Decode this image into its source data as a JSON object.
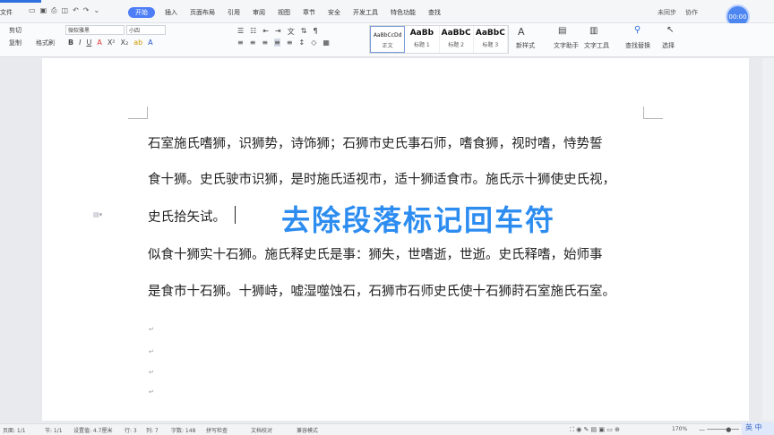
{
  "menubar": {
    "file_label": "文件",
    "tabs": [
      {
        "label": "开始",
        "active": true
      },
      {
        "label": "插入"
      },
      {
        "label": "页面布局"
      },
      {
        "label": "引用"
      },
      {
        "label": "审阅"
      },
      {
        "label": "视图"
      },
      {
        "label": "章节"
      },
      {
        "label": "安全"
      },
      {
        "label": "开发工具"
      },
      {
        "label": "特色功能"
      },
      {
        "label": "查找"
      }
    ],
    "sync_label": "未同步",
    "collab_label": "协作",
    "avatar_text": "00:00"
  },
  "ribbon": {
    "cut": "剪切",
    "paste_format": "格式刷",
    "copy": "复制",
    "font_name": "微软雅黑",
    "font_size": "小四",
    "styles": [
      {
        "sample": "AaBbCcDd",
        "name": "正文"
      },
      {
        "sample": "AaBb",
        "name": "标题 1"
      },
      {
        "sample": "AaBbC",
        "name": "标题 2"
      },
      {
        "sample": "AaBbC",
        "name": "标题 3"
      }
    ],
    "new_style": "新样式",
    "text_assist": "文字助手",
    "text_tools": "文字工具",
    "find_replace": "查找替换",
    "select": "选择"
  },
  "document": {
    "lines": [
      "石室施氏嗜狮，识狮势，诗饰狮；石狮市史氏事石师，嗜食狮，视时嗜，恃势誓",
      "食十狮。史氏驶市识狮，是时施氏适视市，适十狮适食市。施氏示十狮使史氏视，",
      "史氏拾矢试。",
      "似食十狮实十石狮。施氏释史氏是事：狮失，世嗜逝，世逝。史氏释嗜，始师事",
      "是食市十石狮。十狮峙，嘘湿噬蚀石，石狮市石师史氏使十石狮莳石室施氏石室。"
    ],
    "paragraph_mark": "↵",
    "overlay_title": "去除段落标记回车符"
  },
  "status": {
    "page": "页面: 1/1",
    "section": "节: 1/1",
    "position": "设置值: 4.7厘米",
    "row": "行: 3",
    "col": "列: 7",
    "wordcount": "字数: 148",
    "spellcheck": "拼写检查",
    "doc_check": "文档校对",
    "mode": "兼容模式",
    "zoom": "170%",
    "ime": "英 中"
  }
}
